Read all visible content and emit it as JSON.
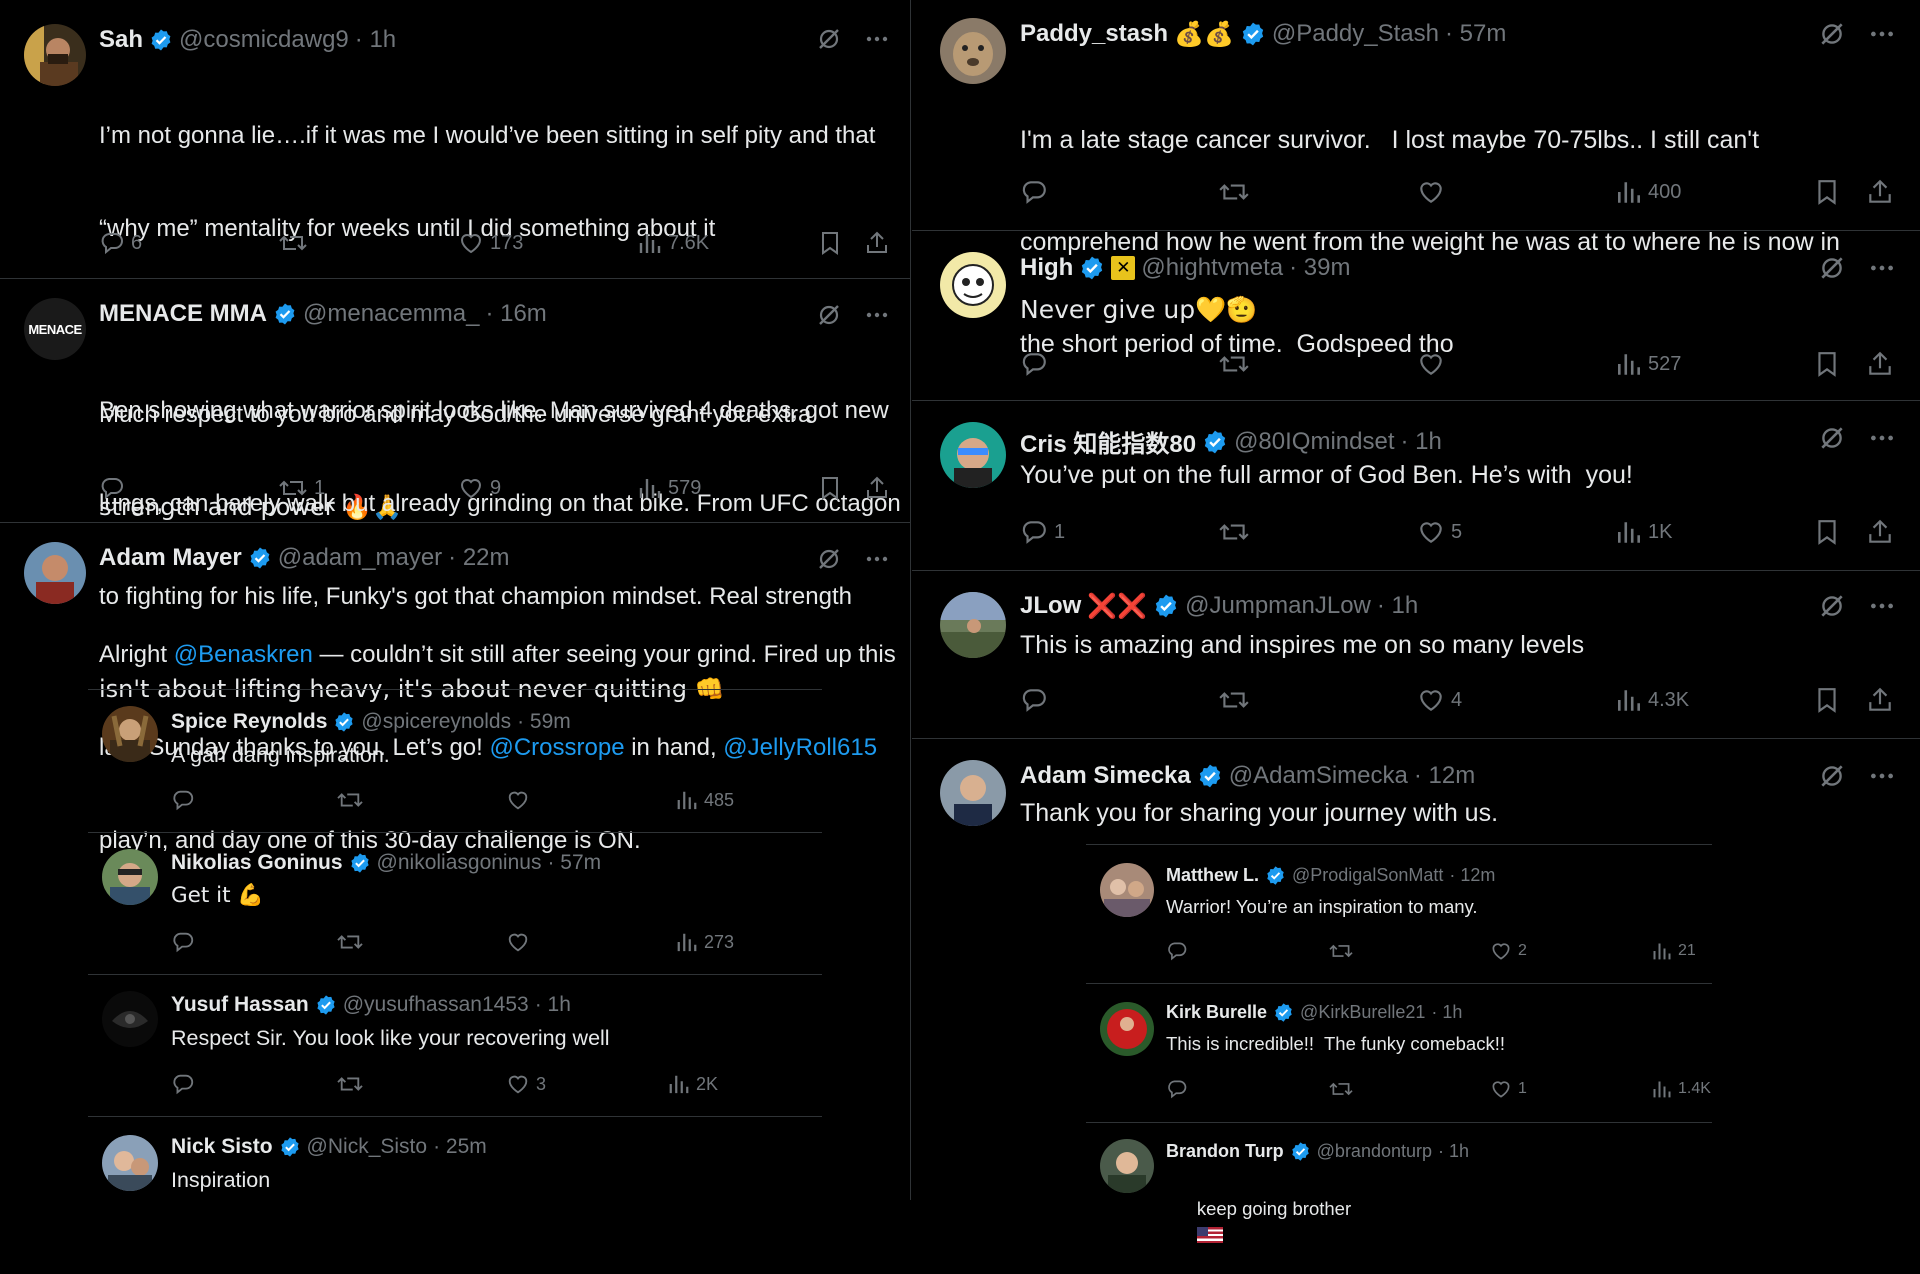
{
  "left": {
    "tweets": [
      {
        "name": "Sah",
        "handle": "@cosmicdawg9",
        "time": "· 1h",
        "lines": [
          "I’m not gonna lie….if it was me I would’ve been sitting in self pity and that",
          "“why me” mentality for weeks until I did something about it",
          "",
          "Much respect to you bro and may God/the universe grant you extra",
          "strength and power 🔥🙏"
        ],
        "reply_count": "6",
        "repost_count": "",
        "like_count": "173",
        "view_count": "7.6K"
      },
      {
        "name": "MENACE MMA",
        "handle": "@menacemma_",
        "time": "· 16m",
        "avatar_text": "MENACE",
        "lines": [
          "Ben showing what warrior spirit looks like. Man survived 4 deaths, got new",
          "lungs, can barely walk but already grinding on that bike. From UFC octagon",
          "to fighting for his life, Funky's got that champion mindset. Real strength",
          "isn't about lifting heavy, it's about never quitting 👊"
        ],
        "reply_count": "",
        "repost_count": "1",
        "like_count": "9",
        "view_count": "579"
      },
      {
        "name": "Adam Mayer",
        "handle": "@adam_mayer",
        "time": "· 22m",
        "line1_a": "Alright ",
        "line1_m": "@Benaskren",
        "line1_b": " — couldn’t sit still after seeing your grind. Fired up this",
        "line2_a": "lazy Sunday thanks to you. Let’s go! ",
        "line2_m1": "@Crossrope",
        "line2_b": " in hand, ",
        "line2_m2": "@JellyRoll615",
        "line3": "play’n, and day one of this 30-day challenge is ON."
      }
    ],
    "replies": [
      {
        "name": "Spice Reynolds",
        "handle": "@spicereynolds",
        "time": "· 59m",
        "text": "A gah dang inspiration.",
        "reply_count": "",
        "repost_count": "",
        "like_count": "",
        "view_count": "485"
      },
      {
        "name": "Nikolias Goninus",
        "handle": "@nikoliasgoninus",
        "time": "· 57m",
        "text": "Get it 💪",
        "reply_count": "",
        "repost_count": "",
        "like_count": "",
        "view_count": "273"
      },
      {
        "name": "Yusuf Hassan",
        "handle": "@yusufhassan1453",
        "time": "· 1h",
        "text": "Respect Sir. You look like your recovering well",
        "reply_count": "",
        "repost_count": "",
        "like_count": "3",
        "view_count": "2K"
      },
      {
        "name": "Nick Sisto",
        "handle": "@Nick_Sisto",
        "time": "· 25m",
        "text": "Inspiration"
      }
    ]
  },
  "right": {
    "tweets": [
      {
        "name": "Paddy_stash",
        "name_emoji": "💰💰",
        "handle": "@Paddy_Stash",
        "time": "· 57m",
        "lines": [
          "I'm a late stage cancer survivor.   I lost maybe 70-75lbs.. I still can't",
          "comprehend how he went from the weight he was at to where he is now in",
          "the short period of time.  Godspeed tho"
        ],
        "reply_count": "",
        "repost_count": "",
        "like_count": "",
        "view_count": "400"
      },
      {
        "name": "High",
        "badge": "✕",
        "handle": "@hightvmeta",
        "time": "· 39m",
        "lines": [
          "Never give up💛🫡"
        ],
        "reply_count": "",
        "repost_count": "",
        "like_count": "",
        "view_count": "527"
      },
      {
        "name": "Cris 知能指数80",
        "handle": "@80IQmindset",
        "time": "· 1h",
        "lines": [
          "You’ve put on the full armor of God Ben. He’s with  you!"
        ],
        "reply_count": "1",
        "repost_count": "",
        "like_count": "5",
        "view_count": "1K"
      },
      {
        "name": "JLow",
        "name_emoji": "❌❌",
        "handle": "@JumpmanJLow",
        "time": "· 1h",
        "lines": [
          "This is amazing and inspires me on so many levels"
        ],
        "reply_count": "",
        "repost_count": "",
        "like_count": "4",
        "view_count": "4.3K"
      },
      {
        "name": "Adam Simecka",
        "handle": "@AdamSimecka",
        "time": "· 12m",
        "lines": [
          "Thank you for sharing your journey with us."
        ]
      }
    ],
    "replies": [
      {
        "name": "Matthew L.",
        "handle": "@ProdigalSonMatt",
        "time": "· 12m",
        "text": "Warrior! You’re an inspiration to many.",
        "reply_count": "",
        "repost_count": "",
        "like_count": "2",
        "view_count": "21"
      },
      {
        "name": "Kirk Burelle",
        "handle": "@KirkBurelle21",
        "time": "· 1h",
        "text": "This is incredible!!  The funky comeback!!",
        "reply_count": "",
        "repost_count": "",
        "like_count": "1",
        "view_count": "1.4K"
      },
      {
        "name": "Brandon Turp",
        "handle": "@brandonturp",
        "time": "· 1h",
        "text": "keep going brother"
      }
    ]
  },
  "colors": {
    "background": "#000000",
    "text": "#e7e9ea",
    "muted": "#71767b",
    "accent": "#1d9bf0",
    "border": "#2f3336"
  }
}
